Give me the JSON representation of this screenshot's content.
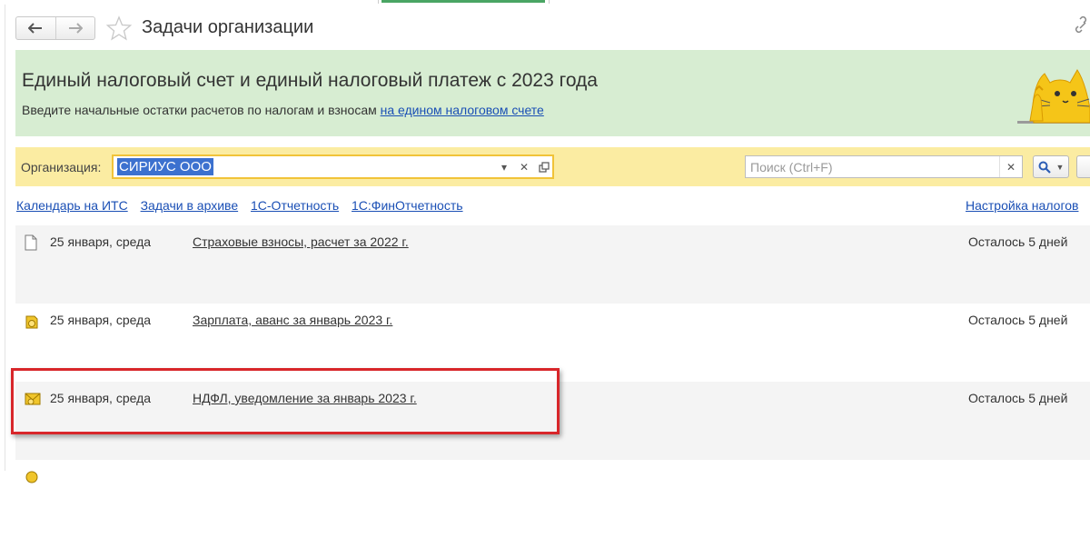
{
  "window": {
    "title": "Задачи организации"
  },
  "banner": {
    "heading": "Единый налоговый счет и единый налоговый платеж с 2023 года",
    "text": "Введите начальные остатки расчетов по налогам и взносам",
    "link": "на едином налоговом счете"
  },
  "filter": {
    "org_label": "Организация:",
    "org_value": "СИРИУС ООО",
    "search_placeholder": "Поиск (Ctrl+F)"
  },
  "links": {
    "items": [
      "Календарь на ИТС",
      "Задачи в архиве",
      "1С-Отчетность",
      "1С:ФинОтчетность"
    ],
    "right": "Настройка налогов"
  },
  "tasks": [
    {
      "date": "25 января, среда",
      "title": "Страховые взносы, расчет за 2022 г.",
      "remaining": "Осталось 5 дней",
      "icon": "document-icon"
    },
    {
      "date": "25 января, среда",
      "title": "Зарплата, аванс за январь 2023 г.",
      "remaining": "Осталось 5 дней",
      "icon": "payment-coin-icon"
    },
    {
      "date": "25 января, среда",
      "title": "НДФЛ, уведомление за январь 2023 г.",
      "remaining": "Осталось 5 дней",
      "icon": "notice-envelope-icon"
    }
  ],
  "colors": {
    "banner_bg": "#d7edd2",
    "filter_bg": "#fbeca2",
    "link": "#1a4fb5",
    "highlight": "#d8262a",
    "selection": "#3c71cf"
  }
}
